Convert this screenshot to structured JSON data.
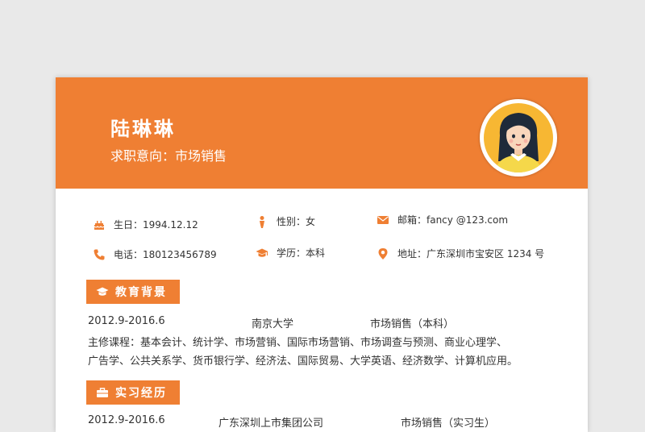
{
  "header": {
    "name": "陆琳琳",
    "job_label": "求职意向：",
    "job_value": "市场销售"
  },
  "info": {
    "birthday": "生日：1994.12.12",
    "gender": "性别：女",
    "email": "邮箱：fancy @123.com",
    "phone": "电话：180123456789",
    "degree": "学历：本科",
    "address": "地址：广东深圳市宝安区 1234 号"
  },
  "education": {
    "title": "教育背景",
    "period": "2012.9-2016.6",
    "school": "南京大学",
    "major": "市场销售（本科）",
    "courses_label": "主修课程：",
    "courses_line1": "主修课程：基本会计、统计学、市场营销、国际市场营销、市场调查与预测、商业心理学、",
    "courses_line2": "广告学、公共关系学、货币银行学、经济法、国际贸易、大学英语、经济数学、计算机应用。"
  },
  "internship": {
    "title": "实习经历",
    "period": "2012.9-2016.6",
    "company": "广东深圳上市集团公司",
    "role": "市场销售（实习生）"
  },
  "colors": {
    "accent": "#ef7f33",
    "page_bg": "#e9e9e9",
    "text": "#333333"
  },
  "icons": [
    "cake-icon",
    "person-icon",
    "mail-icon",
    "phone-icon",
    "graduation-cap-icon",
    "location-pin-icon",
    "briefcase-icon"
  ]
}
